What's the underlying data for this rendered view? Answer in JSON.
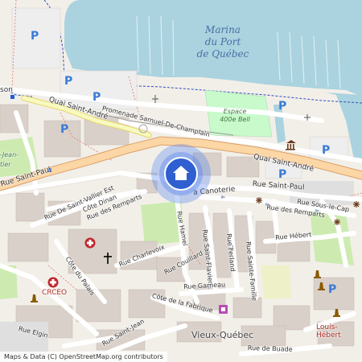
{
  "map": {
    "water": {
      "name": "Marina du Port de Québec",
      "lines": [
        "Marina",
        "du Port",
        "de Québec"
      ]
    },
    "park": {
      "lines": [
        "Espace",
        "400e Bell"
      ]
    },
    "streets": {
      "quai_saint_andre_1": "Quai Saint-André",
      "quai_saint_andre_2": "Quai Saint-André",
      "promenade": "Promenade Samuel-De-Champlain",
      "rue_saint_paul_left": "Rue Saint-Paul",
      "rue_saint_paul_right": "Rue Saint-Paul",
      "rue_de_saint_vallier": "Rue De Saint-Vallier Est",
      "cote_dinan": "Côte Dinan",
      "rue_des_remparts_left": "Rue des Remparts",
      "rue_des_remparts_right": "Rue des Remparts",
      "canoterie": "a Canoterie",
      "rue_sous_le_cap": "Rue Sous-le-Cap",
      "rue_hamel": "Rue Hamel",
      "rue_saint_flavien": "Rue Saint-Flavien",
      "rue_ferland": "Rue Ferland",
      "rue_sainte_famille": "Rue Sainte-Famille",
      "rue_hebert": "Rue Hébert",
      "rue_charlevoix": "Rue Charlevoix",
      "rue_couillard": "Rue Couillard",
      "cote_du_palais": "Côte du Palais",
      "rue_garneau": "Rue Garneau",
      "cote_de_la_fabrique": "Côte de la Fabrique",
      "rue_elgin": "Rue Elgin",
      "rue_saint_jean": "Rue Saint-Jean",
      "rue_de_buade": "Rue de Buade",
      "son": "son",
      "jean": "-Jean-",
      "tier": "tier"
    },
    "places": {
      "vieux_quebec": "Vieux-Québec",
      "crceo": "CRCEO",
      "louis_hebert": "Louis-Hébert"
    },
    "parking_label": "P",
    "attribution": "Maps & Data (C) OpenStreetMap.org contributors",
    "colors": {
      "water": "#aad3df",
      "land": "#f2efe9",
      "park": "#c8facc",
      "building": "#d9d0c9",
      "primary_road": "#fcd6a4",
      "road": "#ffffff",
      "pin": "#2f5fd0",
      "pin_halo": "#4a7cf0",
      "parking": "#3a7bd5"
    },
    "icons": [
      "home-pin-icon",
      "parking-icon",
      "hospital-icon",
      "church-icon",
      "museum-icon",
      "monument-icon",
      "viewpoint-icon",
      "shop-icon"
    ]
  }
}
